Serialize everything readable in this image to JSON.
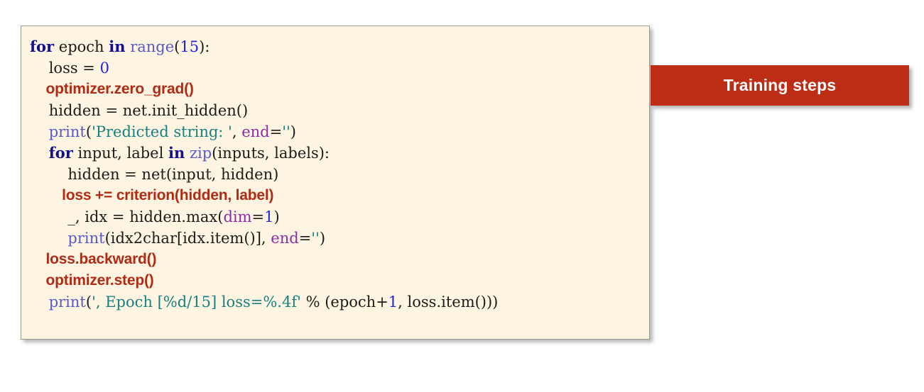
{
  "slide": {
    "background_color": "#ffffff"
  },
  "banner": {
    "label": "Training steps",
    "background_color": "#bd2c14",
    "text_color": "#ffffff"
  },
  "code_block": {
    "background_color": "#fdf5e2",
    "border_color": "#9a9a8e",
    "highlight_color": "#b12a14",
    "language": "python",
    "lines": [
      {
        "indent": 0,
        "highlight": false,
        "plain": "for epoch in range(15):",
        "tokens": [
          {
            "text": "for",
            "type": "kw"
          },
          {
            "text": " epoch ",
            "type": "plain"
          },
          {
            "text": "in",
            "type": "kw"
          },
          {
            "text": " ",
            "type": "plain"
          },
          {
            "text": "range",
            "type": "fn"
          },
          {
            "text": "(",
            "type": "op"
          },
          {
            "text": "15",
            "type": "num"
          },
          {
            "text": "):",
            "type": "op"
          }
        ]
      },
      {
        "indent": 1,
        "highlight": false,
        "plain": "loss = 0",
        "tokens": [
          {
            "text": "loss = ",
            "type": "plain"
          },
          {
            "text": "0",
            "type": "num"
          }
        ]
      },
      {
        "indent": 1,
        "highlight": true,
        "plain": "optimizer.zero_grad()",
        "tokens": [
          {
            "text": "optimizer.zero_grad()",
            "type": "plain"
          }
        ]
      },
      {
        "indent": 1,
        "highlight": false,
        "plain": "hidden = net.init_hidden()",
        "tokens": [
          {
            "text": "hidden = net.",
            "type": "plain"
          },
          {
            "text": "init_hidden",
            "type": "plain"
          },
          {
            "text": "()",
            "type": "op"
          }
        ]
      },
      {
        "indent": 1,
        "highlight": false,
        "plain": "print('Predicted string: ', end='')",
        "tokens": [
          {
            "text": "print",
            "type": "fn"
          },
          {
            "text": "(",
            "type": "op"
          },
          {
            "text": "'Predicted string: '",
            "type": "str"
          },
          {
            "text": ", ",
            "type": "plain"
          },
          {
            "text": "end",
            "type": "kwarg"
          },
          {
            "text": "=",
            "type": "op"
          },
          {
            "text": "''",
            "type": "str"
          },
          {
            "text": ")",
            "type": "op"
          }
        ]
      },
      {
        "indent": 1,
        "highlight": false,
        "plain": "for input, label in zip(inputs, labels):",
        "tokens": [
          {
            "text": "for",
            "type": "kw"
          },
          {
            "text": " input, label ",
            "type": "plain"
          },
          {
            "text": "in",
            "type": "kw"
          },
          {
            "text": " ",
            "type": "plain"
          },
          {
            "text": "zip",
            "type": "fn"
          },
          {
            "text": "(inputs, labels):",
            "type": "op"
          }
        ]
      },
      {
        "indent": 2,
        "highlight": false,
        "plain": "hidden = net(input, hidden)",
        "tokens": [
          {
            "text": "hidden = net(input, hidden)",
            "type": "plain"
          }
        ]
      },
      {
        "indent": 2,
        "highlight": true,
        "plain": "loss += criterion(hidden, label)",
        "tokens": [
          {
            "text": "loss += criterion(hidden, label)",
            "type": "plain"
          }
        ]
      },
      {
        "indent": 2,
        "highlight": false,
        "plain": "_, idx = hidden.max(dim=1)",
        "tokens": [
          {
            "text": "_, idx = hidden.max(",
            "type": "plain"
          },
          {
            "text": "dim",
            "type": "kwarg"
          },
          {
            "text": "=",
            "type": "op"
          },
          {
            "text": "1",
            "type": "num"
          },
          {
            "text": ")",
            "type": "op"
          }
        ]
      },
      {
        "indent": 2,
        "highlight": false,
        "plain": "print(idx2char[idx.item()], end='')",
        "tokens": [
          {
            "text": "print",
            "type": "fn"
          },
          {
            "text": "(idx2char[idx.item()], ",
            "type": "plain"
          },
          {
            "text": "end",
            "type": "kwarg"
          },
          {
            "text": "=",
            "type": "op"
          },
          {
            "text": "''",
            "type": "str"
          },
          {
            "text": ")",
            "type": "op"
          }
        ]
      },
      {
        "indent": 1,
        "highlight": true,
        "plain": "loss.backward()",
        "tokens": [
          {
            "text": "loss.backward()",
            "type": "plain"
          }
        ]
      },
      {
        "indent": 1,
        "highlight": true,
        "plain": "optimizer.step()",
        "tokens": [
          {
            "text": "optimizer.step()",
            "type": "plain"
          }
        ]
      },
      {
        "indent": 1,
        "highlight": false,
        "plain": "print(', Epoch [%d/15] loss=%.4f' % (epoch+1, loss.item()))",
        "tokens": [
          {
            "text": "print",
            "type": "fn"
          },
          {
            "text": "(",
            "type": "op"
          },
          {
            "text": "', Epoch [%d/15] loss=%.4f'",
            "type": "str"
          },
          {
            "text": " % (epoch+",
            "type": "plain"
          },
          {
            "text": "1",
            "type": "num"
          },
          {
            "text": ", loss.item()))",
            "type": "plain"
          }
        ]
      }
    ]
  }
}
